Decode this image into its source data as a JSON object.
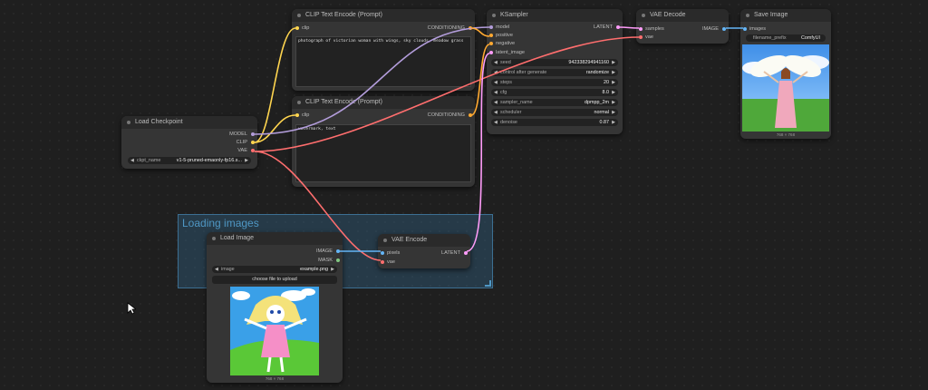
{
  "group": {
    "title": "Loading images"
  },
  "colors": {
    "model": "#b39ddb",
    "clip": "#ffd54f",
    "vae": "#ff6e6e",
    "conditioning": "#ffa931",
    "latent": "#ff9cf9",
    "image": "#64b5f6"
  },
  "nodes": {
    "load_checkpoint": {
      "title": "Load Checkpoint",
      "outputs": [
        "MODEL",
        "CLIP",
        "VAE"
      ],
      "widget": {
        "label": "ckpt_name",
        "value": "v1-5-pruned-emaonly-fp16.s..."
      }
    },
    "clip_pos": {
      "title": "CLIP Text Encode (Prompt)",
      "input": "clip",
      "output": "CONDITIONING",
      "text": "photograph of victorian woman with wings, sky clouds, meadow grass"
    },
    "clip_neg": {
      "title": "CLIP Text Encode (Prompt)",
      "input": "clip",
      "output": "CONDITIONING",
      "text": "watermark, text"
    },
    "ksampler": {
      "title": "KSampler",
      "inputs": [
        "model",
        "positive",
        "negative",
        "latent_image"
      ],
      "output": "LATENT",
      "widgets": [
        {
          "label": "seed",
          "value": "942338294941160"
        },
        {
          "label": "control after generate",
          "value": "randomize"
        },
        {
          "label": "steps",
          "value": "20"
        },
        {
          "label": "cfg",
          "value": "8.0"
        },
        {
          "label": "sampler_name",
          "value": "dpmpp_2m"
        },
        {
          "label": "scheduler",
          "value": "normal"
        },
        {
          "label": "denoise",
          "value": "0.87"
        }
      ]
    },
    "vae_decode": {
      "title": "VAE Decode",
      "inputs": [
        "samples",
        "vae"
      ],
      "output": "IMAGE"
    },
    "save_image": {
      "title": "Save Image",
      "input": "images",
      "widget": {
        "label": "filename_prefix",
        "value": "ComfyUI"
      },
      "caption": "768 × 768"
    },
    "load_image": {
      "title": "Load Image",
      "outputs": [
        "IMAGE",
        "MASK"
      ],
      "widget": {
        "label": "image",
        "value": "example.png"
      },
      "upload_label": "choose file to upload",
      "caption": "768 × 768"
    },
    "vae_encode": {
      "title": "VAE Encode",
      "inputs": [
        "pixels",
        "vae"
      ],
      "output": "LATENT"
    }
  }
}
